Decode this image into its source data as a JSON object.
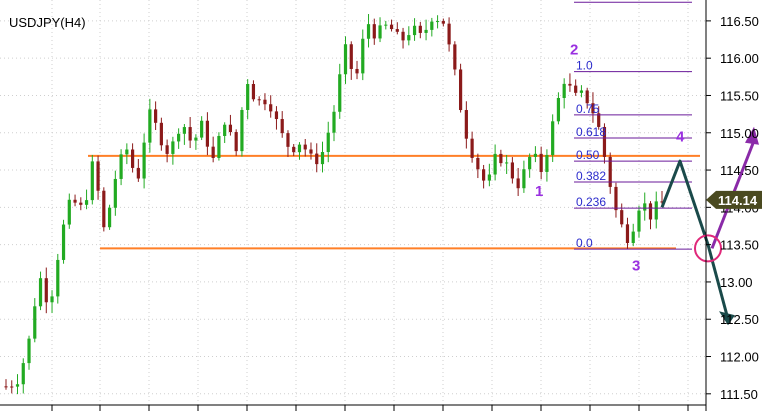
{
  "chart_data": {
    "type": "candlestick",
    "title": "USDJPY(H4)",
    "current_price_label": "114.14",
    "ylim": [
      111.35,
      116.78
    ],
    "y_ticks": [
      "116.50",
      "116.00",
      "115.50",
      "115.00",
      "114.50",
      "114.00",
      "113.50",
      "13.00",
      "112.50",
      "112.00",
      "111.50"
    ],
    "grid": true,
    "colors": {
      "up_candle": "#22aa22",
      "down_candle": "#8b1a1a",
      "horizontal_lines": "#ff7f27",
      "fib_lines": "#6a1a9a",
      "fib_text": "#2b2bcc",
      "wave_labels": "#9a30e0",
      "projection_arrow": "#1a4a4a",
      "bull_arrow": "#8a2aa8",
      "circle": "#e0287a",
      "price_tag": "#4a4a20"
    },
    "horizontal_levels": [
      114.69,
      113.45
    ],
    "fibonacci": {
      "levels": [
        {
          "label": "1.0",
          "price": 115.82
        },
        {
          "label": "0.75",
          "price": 115.24
        },
        {
          "label": "0.618",
          "price": 114.93
        },
        {
          "label": "0.50",
          "price": 114.62
        },
        {
          "label": "0.382",
          "price": 114.34
        },
        {
          "label": "0.236",
          "price": 113.99
        },
        {
          "label": "0.0",
          "price": 113.44
        }
      ],
      "top_line_price": 116.75
    },
    "wave_labels": [
      {
        "label": "1",
        "price": 114.15
      },
      {
        "label": "2",
        "price": 116.05
      },
      {
        "label": "3",
        "price": 113.15
      },
      {
        "label": "4",
        "price": 114.88
      }
    ],
    "projection": {
      "path_prices": [
        114.0,
        114.62,
        113.5,
        112.5
      ],
      "bull_arrow_prices": [
        113.45,
        115.0
      ]
    },
    "anchor_prices": [
      111.6,
      111.7,
      112.1,
      113.1,
      112.7,
      113.6,
      114.1,
      113.95,
      114.6,
      113.65,
      114.4,
      114.8,
      114.35,
      115.25,
      115.0,
      114.7,
      115.2,
      114.85,
      115.1,
      114.6,
      115.2,
      114.7,
      115.75,
      115.4,
      115.5,
      115.0,
      114.8,
      114.9,
      114.6,
      114.75,
      115.3,
      116.1,
      115.7,
      116.5,
      116.3,
      116.45,
      116.2,
      116.4,
      116.25,
      116.6,
      116.5,
      115.8,
      115.05,
      114.6,
      114.25,
      114.75,
      114.5,
      114.3,
      114.7,
      114.5,
      115.1,
      115.75,
      115.45,
      115.5,
      115.2,
      114.5,
      113.8,
      113.6,
      114.1,
      113.9,
      114.05
    ],
    "candle_count": 115
  }
}
